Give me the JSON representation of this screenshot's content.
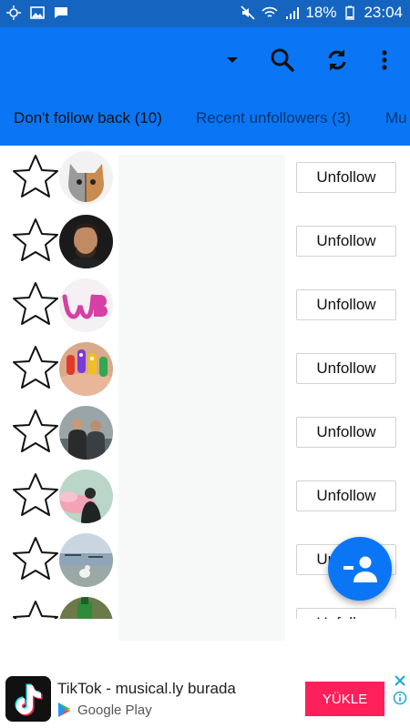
{
  "status_bar": {
    "battery": "18%",
    "time": "23:04"
  },
  "tabs": [
    {
      "label": "Don't follow back (10)"
    },
    {
      "label": "Recent unfollowers (3)"
    },
    {
      "label": "Mu"
    }
  ],
  "list": {
    "button_label": "Unfollow",
    "rows": [
      {
        "avatar": "avatar-cat"
      },
      {
        "avatar": "avatar-man"
      },
      {
        "avatar": "avatar-wb-logo"
      },
      {
        "avatar": "avatar-finger-puppets"
      },
      {
        "avatar": "avatar-two-men"
      },
      {
        "avatar": "avatar-woman-pink-smoke"
      },
      {
        "avatar": "avatar-dog-lake"
      },
      {
        "avatar": "avatar-green-bottle"
      }
    ]
  },
  "ad": {
    "title": "TikTok - musical.ly burada",
    "store": "Google Play",
    "cta": "YÜKLE"
  },
  "colors": {
    "status_bar": "#1565c0",
    "primary": "#0a76f6",
    "ad_cta": "#ff1f5a"
  }
}
